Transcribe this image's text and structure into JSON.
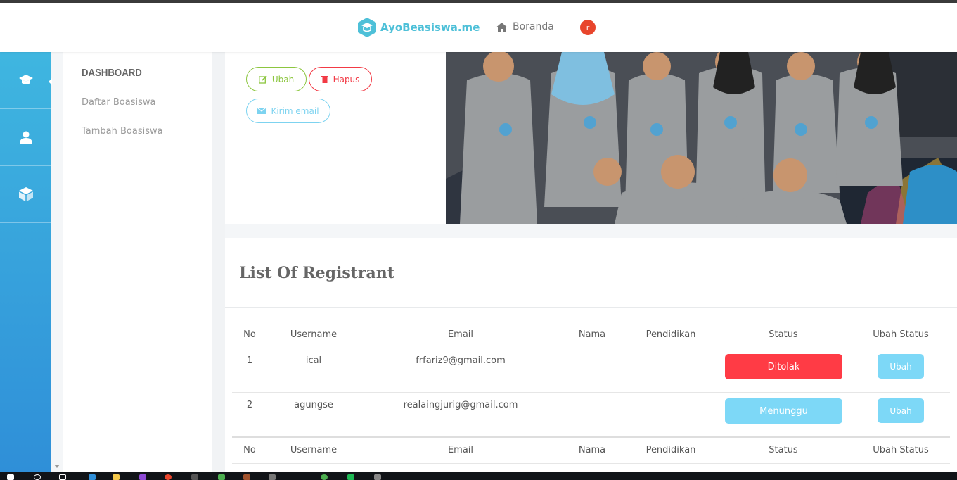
{
  "header": {
    "brand": "AyoBeasiswa.me",
    "nav_home": "Boranda",
    "avatar_text": "r"
  },
  "sidebar": {
    "title": "DASHBOARD",
    "links": [
      "Daftar Boasiswa",
      "Tambah Boasiswa"
    ]
  },
  "actions": {
    "ubah": "Ubah",
    "hapus": "Hapus",
    "kirim_email": "Kirim email"
  },
  "list": {
    "title": "List Of Registrant",
    "columns": [
      "No",
      "Username",
      "Email",
      "Nama",
      "Pendidikan",
      "Status",
      "Ubah Status"
    ],
    "rows": [
      {
        "no": "1",
        "username": "ical",
        "email": "frfariz9@gmail.com",
        "nama": "",
        "pendidikan": "",
        "status": "Ditolak",
        "action": "Ubah"
      },
      {
        "no": "2",
        "username": "agungse",
        "email": "realaingjurig@gmail.com",
        "nama": "",
        "pendidikan": "",
        "status": "Menunggu",
        "action": "Ubah"
      }
    ]
  },
  "colors": {
    "brand": "#4ec0d8",
    "status_ditolak": "#ff3b45",
    "status_menunggu": "#7dd8f7",
    "btn_ubah": "#8cc63f",
    "btn_hapus": "#f23a45",
    "btn_email": "#7dd3f0"
  }
}
